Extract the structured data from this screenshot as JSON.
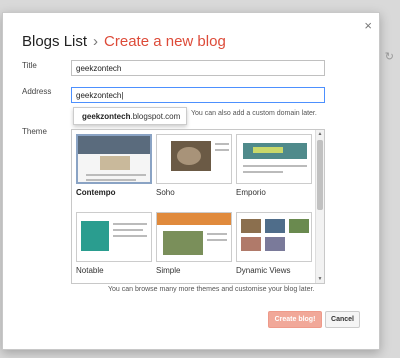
{
  "dialog": {
    "close_label": "×",
    "breadcrumb": "Blogs List",
    "separator": "›",
    "heading": "Create a new blog"
  },
  "form": {
    "title_label": "Title",
    "title_value": "geekzontech",
    "address_label": "Address",
    "address_value": "geekzontech|",
    "suggestion_bold": "geekzontech",
    "suggestion_rest": ".blogspot.com",
    "custom_domain_hint": "You can also add a custom domain later.",
    "theme_label": "Theme"
  },
  "themes": [
    {
      "name": "Contempo",
      "selected": true
    },
    {
      "name": "Soho",
      "selected": false
    },
    {
      "name": "Emporio",
      "selected": false
    },
    {
      "name": "Notable",
      "selected": false
    },
    {
      "name": "Simple",
      "selected": false
    },
    {
      "name": "Dynamic Views",
      "selected": false
    }
  ],
  "browse_text": "You can browse many more themes and customise your blog later.",
  "buttons": {
    "create": "Create blog!",
    "cancel": "Cancel"
  },
  "colors": {
    "accent": "#dd4b39",
    "focus_border": "#4d90fe",
    "create_button": "#f1a899"
  }
}
